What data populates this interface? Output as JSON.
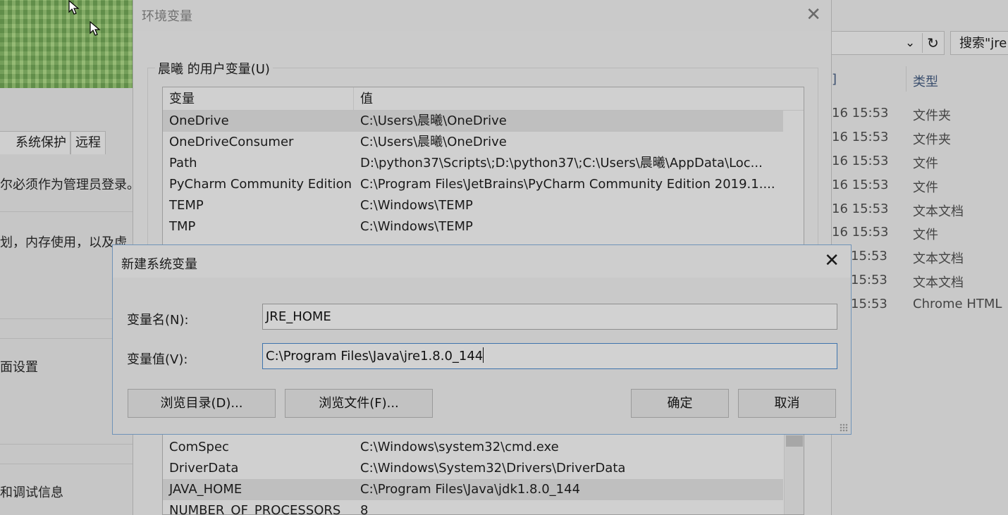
{
  "background_left": {
    "tabs": [
      "系统保护",
      "远程"
    ],
    "texts": [
      "尔必须作为管理员登录。",
      "划，内存使用，以及虚",
      "面设置",
      "和调试信息"
    ]
  },
  "background_right": {
    "search_placeholder": "搜索\"jre",
    "column_date_partial": "]",
    "column_type": "类型",
    "rows": [
      {
        "date": "16 15:53",
        "type": "文件夹"
      },
      {
        "date": "16 15:53",
        "type": "文件夹"
      },
      {
        "date": "16 15:53",
        "type": "文件"
      },
      {
        "date": "16 15:53",
        "type": "文件"
      },
      {
        "date": "16 15:53",
        "type": "文本文档"
      },
      {
        "date": "16 15:53",
        "type": "文件"
      },
      {
        "date": "15:53",
        "type": "文本文档"
      },
      {
        "date": "15:53",
        "type": "文本文档"
      },
      {
        "date": "15:53",
        "type": "Chrome HTML"
      }
    ]
  },
  "env_dialog": {
    "title": "环境变量",
    "close_glyph": "✕",
    "user_group_label": "晨曦 的用户变量(U)",
    "col_variable": "变量",
    "col_value": "值",
    "user_vars": [
      {
        "name": "OneDrive",
        "value": "C:\\Users\\晨曦\\OneDrive"
      },
      {
        "name": "OneDriveConsumer",
        "value": "C:\\Users\\晨曦\\OneDrive"
      },
      {
        "name": "Path",
        "value": "D:\\python37\\Scripts\\;D:\\python37\\;C:\\Users\\晨曦\\AppData\\Loc..."
      },
      {
        "name": "PyCharm Community Edition",
        "value": "C:\\Program Files\\JetBrains\\PyCharm Community Edition 2019.1...."
      },
      {
        "name": "TEMP",
        "value": "C:\\Windows\\TEMP"
      },
      {
        "name": "TMP",
        "value": "C:\\Windows\\TEMP"
      }
    ],
    "system_vars": [
      {
        "name": "ComSpec",
        "value": "C:\\Windows\\system32\\cmd.exe"
      },
      {
        "name": "DriverData",
        "value": "C:\\Windows\\System32\\Drivers\\DriverData"
      },
      {
        "name": "JAVA_HOME",
        "value": "C:\\Program Files\\Java\\jdk1.8.0_144"
      },
      {
        "name": "NUMBER_OF_PROCESSORS",
        "value": "8"
      }
    ]
  },
  "new_var_dialog": {
    "title": "新建系统变量",
    "close_glyph": "✕",
    "name_label": "变量名(N):",
    "name_value": "JRE_HOME",
    "value_label": "变量值(V):",
    "value_value": "C:\\Program Files\\Java\\jre1.8.0_144",
    "browse_dir": "浏览目录(D)...",
    "browse_file": "浏览文件(F)...",
    "ok": "确定",
    "cancel": "取消"
  }
}
